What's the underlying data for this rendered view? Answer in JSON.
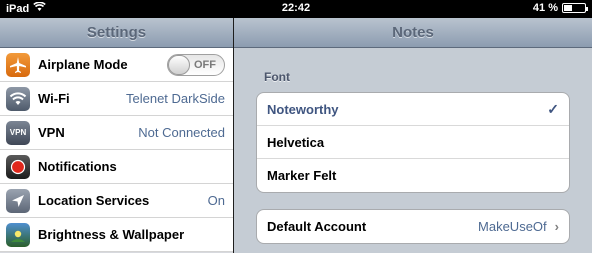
{
  "status": {
    "carrier": "iPad",
    "time": "22:42",
    "battery_percent": "41 %",
    "battery_level": 0.41
  },
  "left": {
    "title": "Settings",
    "items": [
      {
        "label": "Airplane Mode",
        "icon": "airplane-icon",
        "toggle": "OFF"
      },
      {
        "label": "Wi-Fi",
        "icon": "wifi-icon",
        "value": "Telenet DarkSide"
      },
      {
        "label": "VPN",
        "icon": "vpn-icon",
        "icon_text": "VPN",
        "value": "Not Connected"
      },
      {
        "label": "Notifications",
        "icon": "notifications-icon"
      },
      {
        "label": "Location Services",
        "icon": "location-icon",
        "value": "On"
      },
      {
        "label": "Brightness & Wallpaper",
        "icon": "brightness-icon"
      }
    ]
  },
  "right": {
    "title": "Notes",
    "font_section": "Font",
    "fonts": [
      {
        "label": "Noteworthy",
        "selected": true
      },
      {
        "label": "Helvetica",
        "selected": false
      },
      {
        "label": "Marker Felt",
        "selected": false
      }
    ],
    "check_mark": "✓",
    "default_account": {
      "label": "Default Account",
      "value": "MakeUseOf",
      "chevron": "›"
    }
  },
  "colors": {
    "accent_blue": "#3f5580",
    "value_blue": "#4e6a92",
    "navbar_top": "#b9c3cf",
    "navbar_bottom": "#8c9cb0"
  }
}
